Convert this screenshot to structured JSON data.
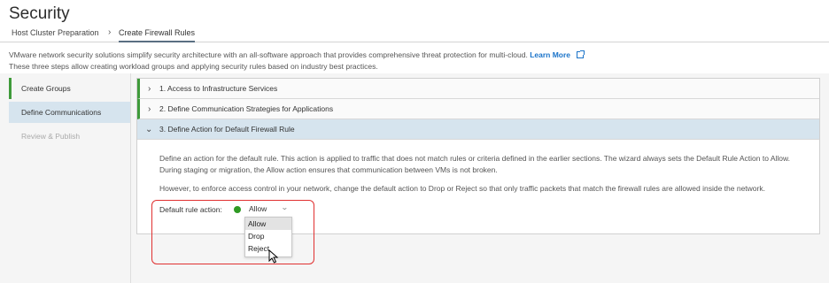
{
  "page": {
    "title": "Security"
  },
  "tabs": [
    {
      "label": "Host Cluster Preparation"
    },
    {
      "label": "Create Firewall Rules"
    }
  ],
  "tab_separator": "›",
  "description": {
    "line1": "VMware network security solutions simplify security architecture with an all-software approach that provides comprehensive threat protection for multi-cloud.",
    "link": "Learn More",
    "line2": "These three steps allow creating workload groups and applying security rules based on industry best practices."
  },
  "steps": [
    {
      "label": "Create Groups",
      "state": "completed"
    },
    {
      "label": "Define Communications",
      "state": "active"
    },
    {
      "label": "Review & Publish",
      "state": "disabled"
    }
  ],
  "accordion": [
    {
      "label": "1. Access to Infrastructure Services",
      "expanded": false,
      "chevron": "›"
    },
    {
      "label": "2. Define Communication Strategies for Applications",
      "expanded": false,
      "chevron": "›"
    },
    {
      "label": "3. Define Action for Default Firewall Rule",
      "expanded": true,
      "chevron": "⌄"
    }
  ],
  "section3": {
    "para1_line1": "Define an action for the default rule. This action is applied to traffic that does not match rules or criteria defined in the earlier sections. The wizard always sets the Default Rule Action to Allow.",
    "para1_line2": "During staging or migration, the Allow action ensures that communication between VMs is not broken.",
    "para2": "However, to enforce access control in your network, change the default action to Drop or Reject so that only traffic packets that match the firewall rules are allowed inside the network.",
    "rule_label": "Default rule action:",
    "selected_value": "Allow",
    "caret": "⌄",
    "options": [
      "Allow",
      "Drop",
      "Reject"
    ]
  },
  "colors": {
    "accent_green": "#3f9a3a",
    "status_green": "#2f9a24",
    "link_blue": "#1a73c9",
    "active_bg": "#d6e4ee",
    "highlight_red": "#e03030"
  }
}
